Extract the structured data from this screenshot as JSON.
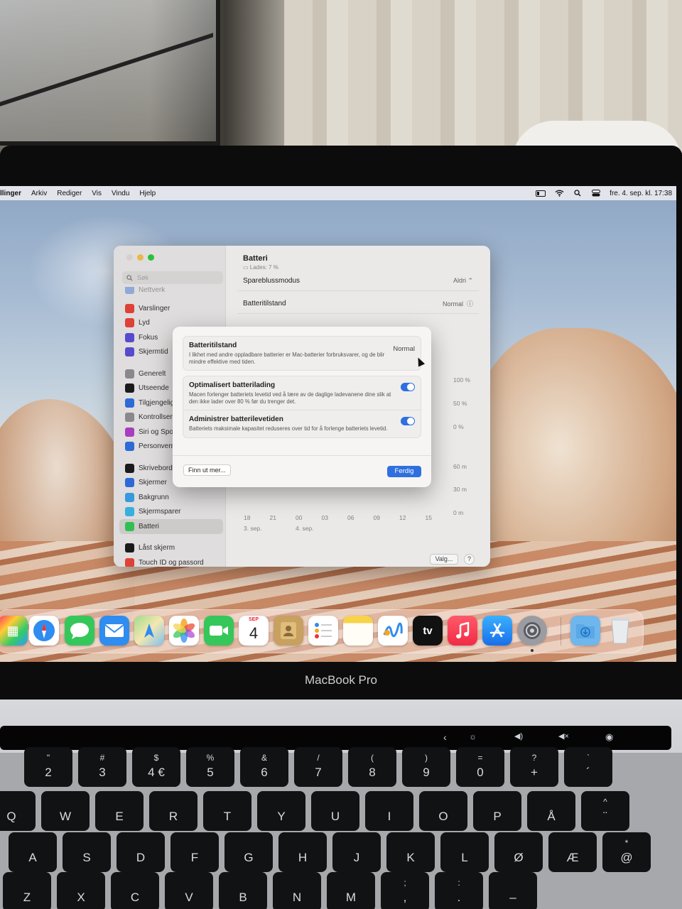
{
  "menubar": {
    "items": [
      "llinger",
      "Arkiv",
      "Rediger",
      "Vis",
      "Vindu",
      "Hjelp"
    ],
    "clock": "fre. 4. sep. kl. 17:38"
  },
  "settings": {
    "search_placeholder": "Søk",
    "sidebar": {
      "partial_top": "Nettverk",
      "groups": [
        [
          {
            "label": "Varslinger",
            "color": "#e8443a"
          },
          {
            "label": "Lyd",
            "color": "#e8443a"
          },
          {
            "label": "Fokus",
            "color": "#5b4fd6"
          },
          {
            "label": "Skjermtid",
            "color": "#5b4fd6"
          }
        ],
        [
          {
            "label": "Generelt",
            "color": "#8e8e93"
          },
          {
            "label": "Utseende",
            "color": "#1c1c1e"
          },
          {
            "label": "Tilgjengelig",
            "color": "#2f6fe0"
          },
          {
            "label": "Kontrollsen",
            "color": "#8e8e93"
          },
          {
            "label": "Siri og Spo",
            "color": "#b040c8"
          },
          {
            "label": "Personvern",
            "color": "#2f6fe0"
          }
        ],
        [
          {
            "label": "Skrivebord",
            "color": "#1c1c1e"
          },
          {
            "label": "Skjermer",
            "color": "#2f6fe0"
          },
          {
            "label": "Bakgrunn",
            "color": "#3aa0e8"
          },
          {
            "label": "Skjermsparer",
            "color": "#3ab8e8"
          },
          {
            "label": "Batteri",
            "color": "#34c759"
          }
        ],
        [
          {
            "label": "Låst skjerm",
            "color": "#1c1c1e"
          },
          {
            "label": "Touch ID og passord",
            "color": "#e8443a"
          }
        ]
      ]
    },
    "pane": {
      "title": "Batteri",
      "subtitle": "Lades: 7 %",
      "rows": [
        {
          "label": "Spareblussmodus",
          "value": "Aldri"
        },
        {
          "label": "Batteritilstand",
          "value": "Normal"
        }
      ],
      "chart_right_labels": [
        "100 %",
        "50 %",
        "0 %",
        "60 m",
        "30 m",
        "0 m"
      ],
      "chart_x_labels": [
        "18",
        "21",
        "00",
        "03",
        "06",
        "09",
        "12",
        "15"
      ],
      "chart_dates": [
        "3. sep.",
        "4. sep."
      ],
      "options_button": "Valg...",
      "help_button": "?"
    }
  },
  "modal": {
    "health_title": "Batteritilstand",
    "health_value": "Normal",
    "health_desc": "I likhet med andre oppladbare batterier er Mac-batterier forbruksvarer, og de blir mindre effektive med tiden.",
    "optimized_title": "Optimalisert batterilading",
    "optimized_desc": "Macen forlenger batteriets levetid ved å lære av de daglige ladevanene dine slik at den ikke lader over 80 % før du trenger det.",
    "optimized_on": true,
    "manage_title": "Administrer batterilevetiden",
    "manage_desc": "Batteriets maksimale kapasitet reduseres over tid for å forlenge batteriets levetid.",
    "manage_on": true,
    "learn_more": "Finn ut mer...",
    "done": "Ferdig"
  },
  "dock": {
    "calendar_month": "SEP",
    "calendar_day": "4",
    "tv_label": "tv",
    "apps": [
      "launchpad",
      "safari",
      "messages",
      "mail",
      "maps",
      "photos",
      "facetime",
      "calendar",
      "contacts",
      "reminders",
      "notes",
      "freeform",
      "apple-tv",
      "music",
      "app-store",
      "system-settings",
      "downloads",
      "trash"
    ]
  },
  "laptop": {
    "brand": "MacBook Pro"
  },
  "keyboard": {
    "rows": [
      [
        {
          "t": "\"",
          "m": "2"
        },
        {
          "t": "#",
          "m": "3"
        },
        {
          "t": "$",
          "m": "4 €"
        },
        {
          "t": "%",
          "m": "5"
        },
        {
          "t": "&",
          "m": "6"
        },
        {
          "t": "/",
          "m": "7"
        },
        {
          "t": "(",
          "m": "8"
        },
        {
          "t": ")",
          "m": "9"
        },
        {
          "t": "=",
          "m": "0"
        },
        {
          "t": "?",
          "m": "+"
        },
        {
          "t": "`",
          "m": "´"
        }
      ],
      [
        {
          "t": "",
          "m": "Q"
        },
        {
          "t": "",
          "m": "W"
        },
        {
          "t": "",
          "m": "E"
        },
        {
          "t": "",
          "m": "R"
        },
        {
          "t": "",
          "m": "T"
        },
        {
          "t": "",
          "m": "Y"
        },
        {
          "t": "",
          "m": "U"
        },
        {
          "t": "",
          "m": "I"
        },
        {
          "t": "",
          "m": "O"
        },
        {
          "t": "",
          "m": "P"
        },
        {
          "t": "",
          "m": "Å"
        },
        {
          "t": "^",
          "m": "¨"
        }
      ],
      [
        {
          "t": "",
          "m": "A"
        },
        {
          "t": "",
          "m": "S"
        },
        {
          "t": "",
          "m": "D"
        },
        {
          "t": "",
          "m": "F"
        },
        {
          "t": "",
          "m": "G"
        },
        {
          "t": "",
          "m": "H"
        },
        {
          "t": "",
          "m": "J"
        },
        {
          "t": "",
          "m": "K"
        },
        {
          "t": "",
          "m": "L"
        },
        {
          "t": "",
          "m": "Ø"
        },
        {
          "t": "",
          "m": "Æ"
        },
        {
          "t": "*",
          "m": "@"
        }
      ],
      [
        {
          "t": "",
          "m": "Z"
        },
        {
          "t": "",
          "m": "X"
        },
        {
          "t": "",
          "m": "C"
        },
        {
          "t": "",
          "m": "V"
        },
        {
          "t": "",
          "m": "B"
        },
        {
          "t": "",
          "m": "N"
        },
        {
          "t": "",
          "m": "M"
        },
        {
          "t": ";",
          "m": ","
        },
        {
          "t": ":",
          "m": "."
        },
        {
          "t": "",
          "m": "–"
        }
      ]
    ]
  }
}
